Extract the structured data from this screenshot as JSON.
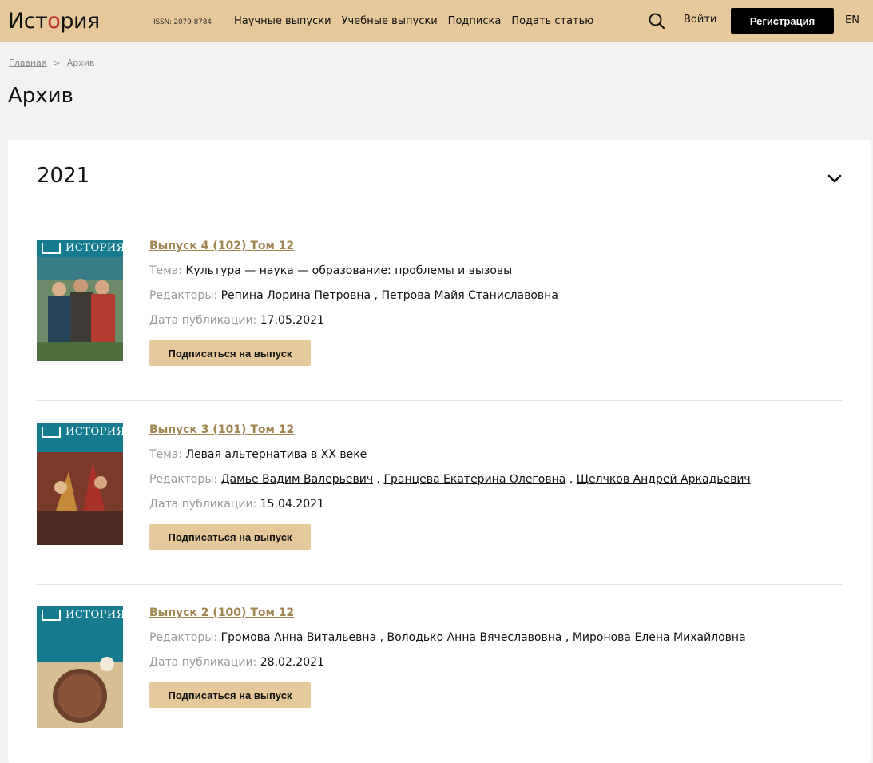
{
  "header": {
    "logo_prefix": "Ист",
    "logo_accent": "о",
    "logo_suffix": "рия",
    "issn": "ISSN: 2079-8784",
    "nav": [
      "Научные выпуски",
      "Учебные выпуски",
      "Подписка",
      "Подать статью"
    ],
    "login": "Войти",
    "register": "Регистрация",
    "lang": "EN"
  },
  "breadcrumb": {
    "home": "Главная",
    "separator": ">",
    "current": "Архив"
  },
  "page_title": "Архив",
  "year": "2021",
  "labels": {
    "theme": "Тема:",
    "editors": "Редакторы:",
    "date": "Дата публикации:",
    "subscribe": "Подписаться на выпуск",
    "cover_title": "ИСТОРИЯ"
  },
  "issues": [
    {
      "title": "Выпуск 4 (102) Том 12",
      "theme": "Культура — наука — образование: проблемы и вызовы",
      "editors": [
        "Репина Лорина Петровна",
        "Петрова Майя Станиславовна"
      ],
      "date": "17.05.2021",
      "cover_color": "#2f6f7a"
    },
    {
      "title": "Выпуск 3 (101) Том 12",
      "theme": "Левая альтернатива в XX веке",
      "editors": [
        "Дамье Вадим Валерьевич",
        "Гранцева Екатерина Олеговна",
        "Щелчков Андрей Аркадьевич"
      ],
      "date": "15.04.2021",
      "cover_color": "#8c3b2a"
    },
    {
      "title": "Выпуск 2 (100) Том 12",
      "editors": [
        "Громова Анна Витальевна",
        "Володько Анна Вячеславовна",
        "Миронова Елена Михайловна"
      ],
      "date": "28.02.2021",
      "cover_color": "#c9a97a"
    }
  ],
  "colors": {
    "header_bg": "#e6c99b",
    "link_gold": "#a08553",
    "button_dark": "#000000"
  }
}
